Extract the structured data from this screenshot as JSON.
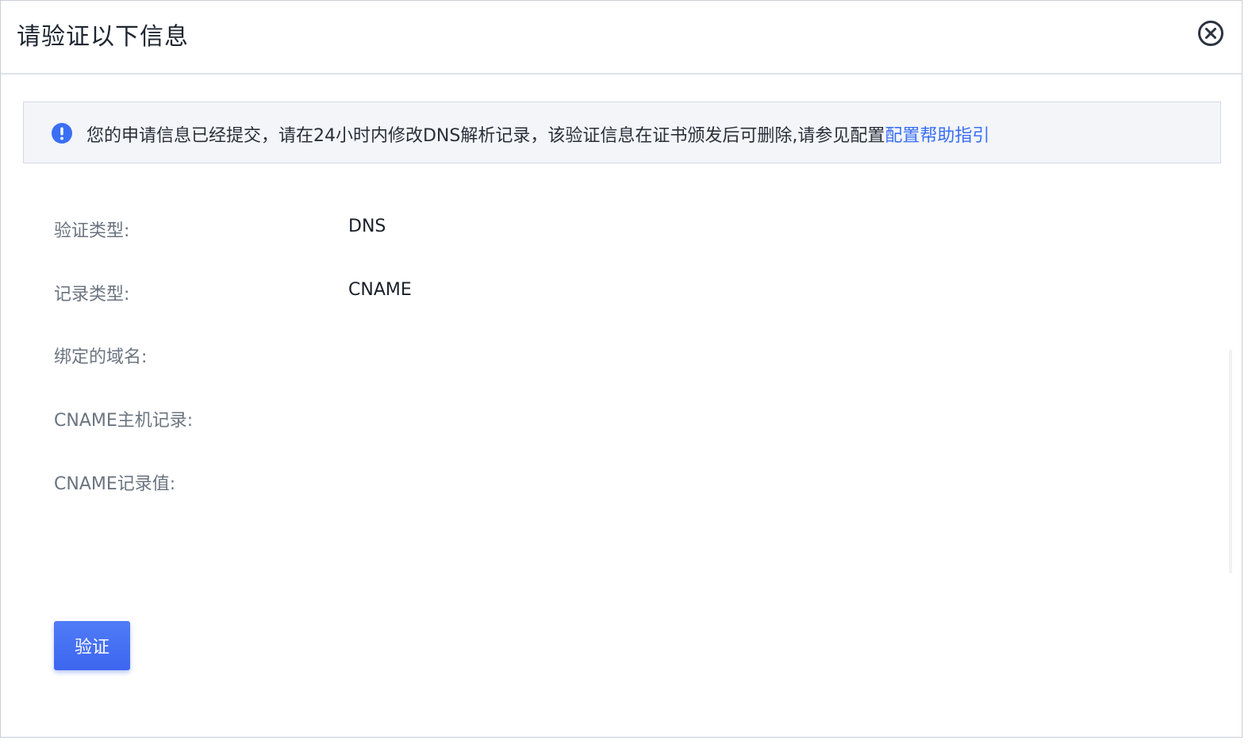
{
  "dialog": {
    "title": "请验证以下信息",
    "close_icon": "close-circle-icon"
  },
  "notice": {
    "icon": "exclamation-circle-icon",
    "text": "您的申请信息已经提交，请在24小时内修改DNS解析记录，该验证信息在证书颁发后可删除,请参见配置",
    "link_text": "配置帮助指引",
    "accent_color": "#3a6ff5"
  },
  "fields": {
    "verify_type": {
      "label": "验证类型:",
      "value": "DNS"
    },
    "record_type": {
      "label": "记录类型:",
      "value": "CNAME"
    },
    "bound_domain": {
      "label": "绑定的域名:",
      "value": ""
    },
    "cname_host": {
      "label": "CNAME主机记录:",
      "value": ""
    },
    "cname_value": {
      "label": "CNAME记录值:",
      "value": ""
    }
  },
  "actions": {
    "verify_label": "验证",
    "primary_color": "#4a74f5"
  }
}
